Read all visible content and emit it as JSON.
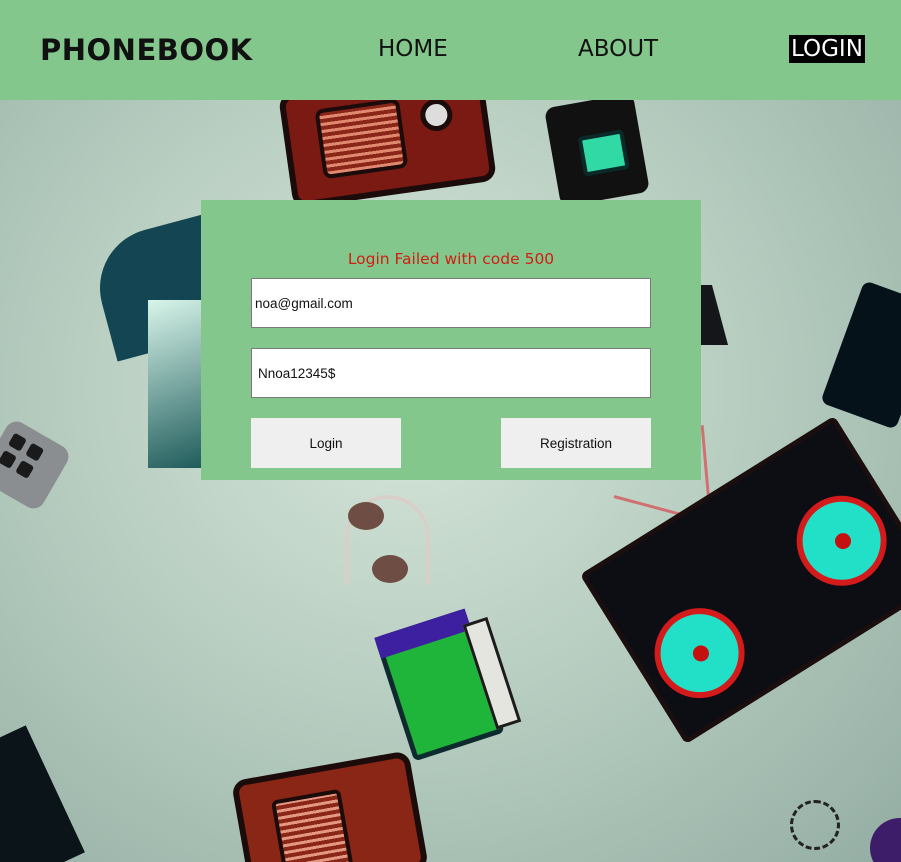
{
  "header": {
    "brand": "PHONEBOOK",
    "nav": {
      "home": "HOME",
      "about": "ABOUT",
      "login": "LOGIN"
    }
  },
  "login_form": {
    "error_message": "Login Failed with code 500",
    "email_value": "noa@gmail.com",
    "password_value": "Nnoa12345$",
    "login_button": "Login",
    "registration_button": "Registration"
  },
  "colors": {
    "header_bg": "#84c78d",
    "card_bg": "#84c78d",
    "error_text": "#d01e12",
    "active_nav_bg": "#000000"
  }
}
